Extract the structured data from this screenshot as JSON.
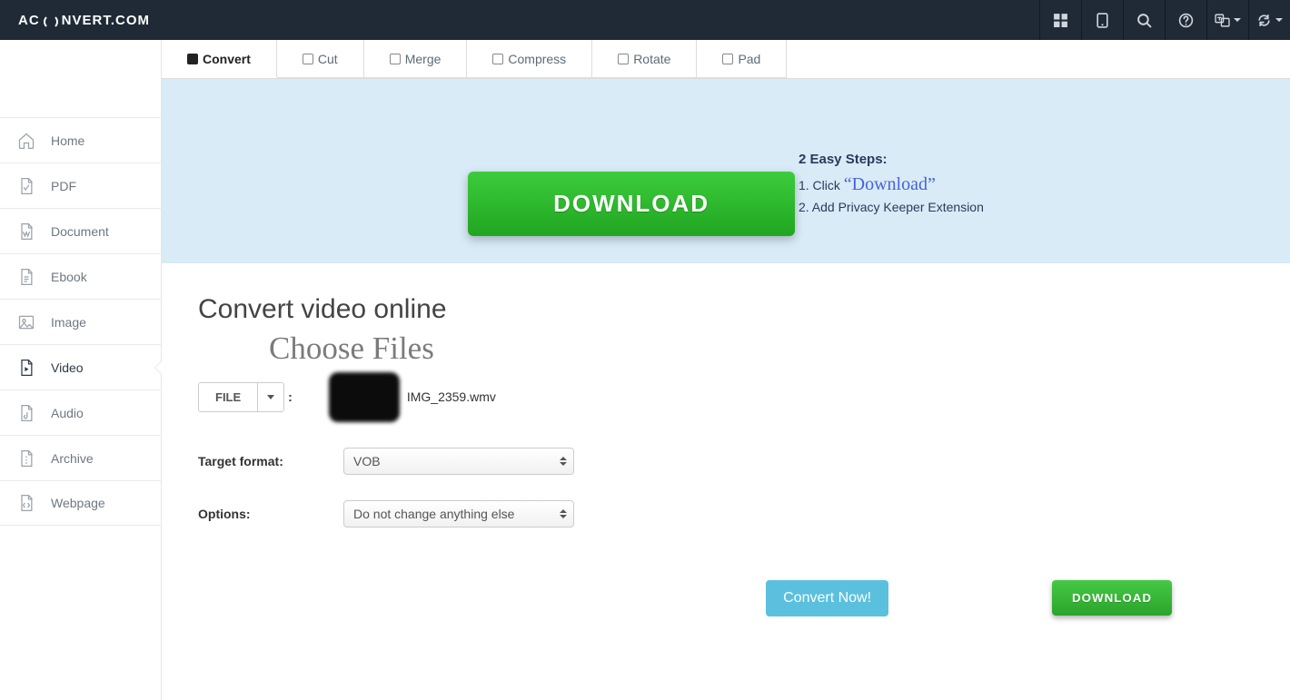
{
  "brand": {
    "prefix": "AC",
    "suffix": "NVERT.COM"
  },
  "sidebar": {
    "items": [
      {
        "label": "Home"
      },
      {
        "label": "PDF"
      },
      {
        "label": "Document"
      },
      {
        "label": "Ebook"
      },
      {
        "label": "Image"
      },
      {
        "label": "Video"
      },
      {
        "label": "Audio"
      },
      {
        "label": "Archive"
      },
      {
        "label": "Webpage"
      }
    ]
  },
  "tabs": [
    {
      "label": "Convert"
    },
    {
      "label": "Cut"
    },
    {
      "label": "Merge"
    },
    {
      "label": "Compress"
    },
    {
      "label": "Rotate"
    },
    {
      "label": "Pad"
    }
  ],
  "ad": {
    "download": "DOWNLOAD",
    "head": "2 Easy Steps:",
    "step1_pre": "1. Click ",
    "step1_dl": "“Download”",
    "step2": "2. Add Privacy Keeper Extension",
    "download_small": "DOWNLOAD"
  },
  "page": {
    "title": "Convert video online",
    "choose": "Choose Files",
    "file_button": "FILE",
    "file_name": "IMG_2359.wmv",
    "target_label": "Target format:",
    "target_value": "VOB",
    "options_label": "Options:",
    "options_value": "Do not change anything else",
    "convert_btn": "Convert Now!"
  }
}
